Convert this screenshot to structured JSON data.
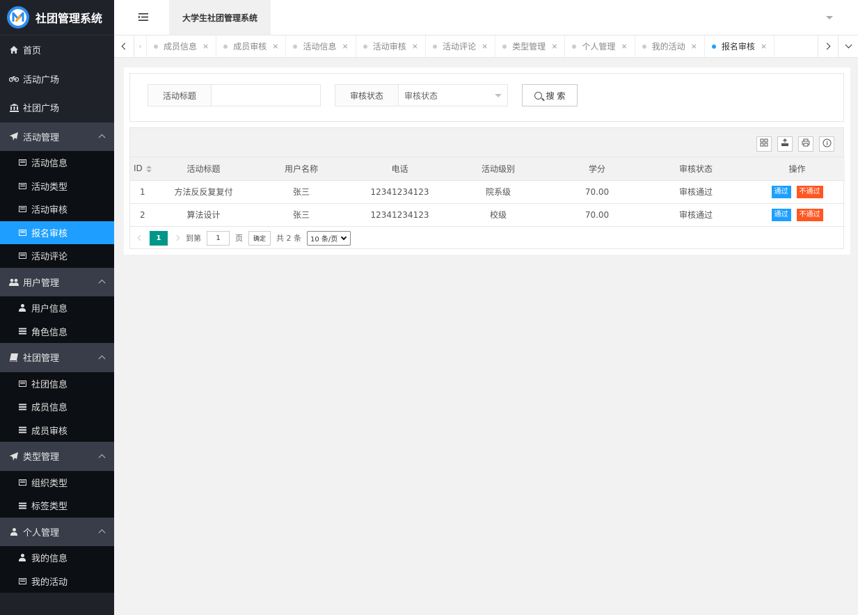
{
  "app": {
    "name": "社团管理系统",
    "header_title": "大学生社团管理系统"
  },
  "sidebar": {
    "top_items": [
      {
        "label": "首页",
        "icon": "home-icon"
      },
      {
        "label": "活动广场",
        "icon": "bicycle-icon"
      },
      {
        "label": "社团广场",
        "icon": "bank-icon"
      }
    ],
    "groups": [
      {
        "label": "活动管理",
        "icon": "paper-plane-icon",
        "items": [
          "活动信息",
          "活动类型",
          "活动审核",
          "报名审核",
          "活动评论"
        ]
      },
      {
        "label": "用户管理",
        "icon": "users-icon",
        "items": [
          "用户信息",
          "角色信息"
        ]
      },
      {
        "label": "社团管理",
        "icon": "book-icon",
        "items": [
          "社团信息",
          "成员信息",
          "成员审核"
        ]
      },
      {
        "label": "类型管理",
        "icon": "paper-plane-icon",
        "items": [
          "组织类型",
          "标签类型"
        ]
      },
      {
        "label": "个人管理",
        "icon": "user-icon",
        "items": [
          "我的信息",
          "我的活动"
        ]
      }
    ],
    "active_item": "报名审核"
  },
  "tabs": {
    "items": [
      "成员信息",
      "成员审核",
      "活动信息",
      "活动审核",
      "活动评论",
      "类型管理",
      "个人管理",
      "我的活动",
      "报名审核"
    ],
    "active": "报名审核",
    "close_glyph": "×"
  },
  "search": {
    "title_label": "活动标题",
    "title_value": "",
    "status_label": "审核状态",
    "status_placeholder": "审核状态",
    "button_label": "搜 索"
  },
  "table": {
    "columns": [
      "ID",
      "活动标题",
      "用户名称",
      "电话",
      "活动级别",
      "学分",
      "审核状态",
      "操作"
    ],
    "rows": [
      {
        "id": "1",
        "title": "方法反反复复付",
        "user": "张三",
        "phone": "12341234123",
        "level": "院系级",
        "credit": "70.00",
        "status": "审核通过"
      },
      {
        "id": "2",
        "title": "算法设计",
        "user": "张三",
        "phone": "12341234123",
        "level": "校级",
        "credit": "70.00",
        "status": "审核通过"
      }
    ],
    "pass_label": "通过",
    "reject_label": "不通过"
  },
  "pager": {
    "current": "1",
    "goto_label": "到第",
    "goto_value": "1",
    "page_unit": "页",
    "confirm_label": "确定",
    "total_label": "共 2 条",
    "limit_label": "10 条/页"
  },
  "colors": {
    "accent": "#1e9fff",
    "danger": "#ff5722",
    "pager": "#009688",
    "sidebar": "#20222a"
  }
}
